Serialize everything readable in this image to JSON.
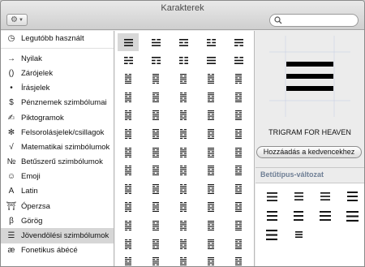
{
  "window": {
    "title": "Karakterek"
  },
  "toolbar": {
    "gear_icon": "gear-icon"
  },
  "sidebar": {
    "items": [
      {
        "icon": "◷",
        "label": "Legutóbb használt"
      },
      {
        "icon": "→",
        "label": "Nyilak"
      },
      {
        "icon": "()",
        "label": "Zárójelek"
      },
      {
        "icon": "•",
        "label": "Írásjelek"
      },
      {
        "icon": "$",
        "label": "Pénznemek szimbólumai"
      },
      {
        "icon": "✍",
        "label": "Piktogramok"
      },
      {
        "icon": "✻",
        "label": "Felsorolásjelek/csillagok"
      },
      {
        "icon": "√",
        "label": "Matematikai szimbólumok"
      },
      {
        "icon": "№",
        "label": "Betűszerű szimbólumok"
      },
      {
        "icon": "☺",
        "label": "Emoji"
      },
      {
        "icon": "A",
        "label": "Latin"
      },
      {
        "icon": "⛩",
        "label": "Óperzsa"
      },
      {
        "icon": "β",
        "label": "Görög"
      },
      {
        "icon": "☰",
        "label": "Jövendölési szimbólumok"
      },
      {
        "icon": "æ",
        "label": "Fonetikus ábécé"
      }
    ],
    "selected_index": 13
  },
  "preview": {
    "glyph": "trigram-heaven"
  },
  "details": {
    "char_name": "TRIGRAM FOR HEAVEN",
    "add_favorite": "Hozzáadás a kedvencekhez",
    "font_variation": "Betűtípus-változat"
  }
}
